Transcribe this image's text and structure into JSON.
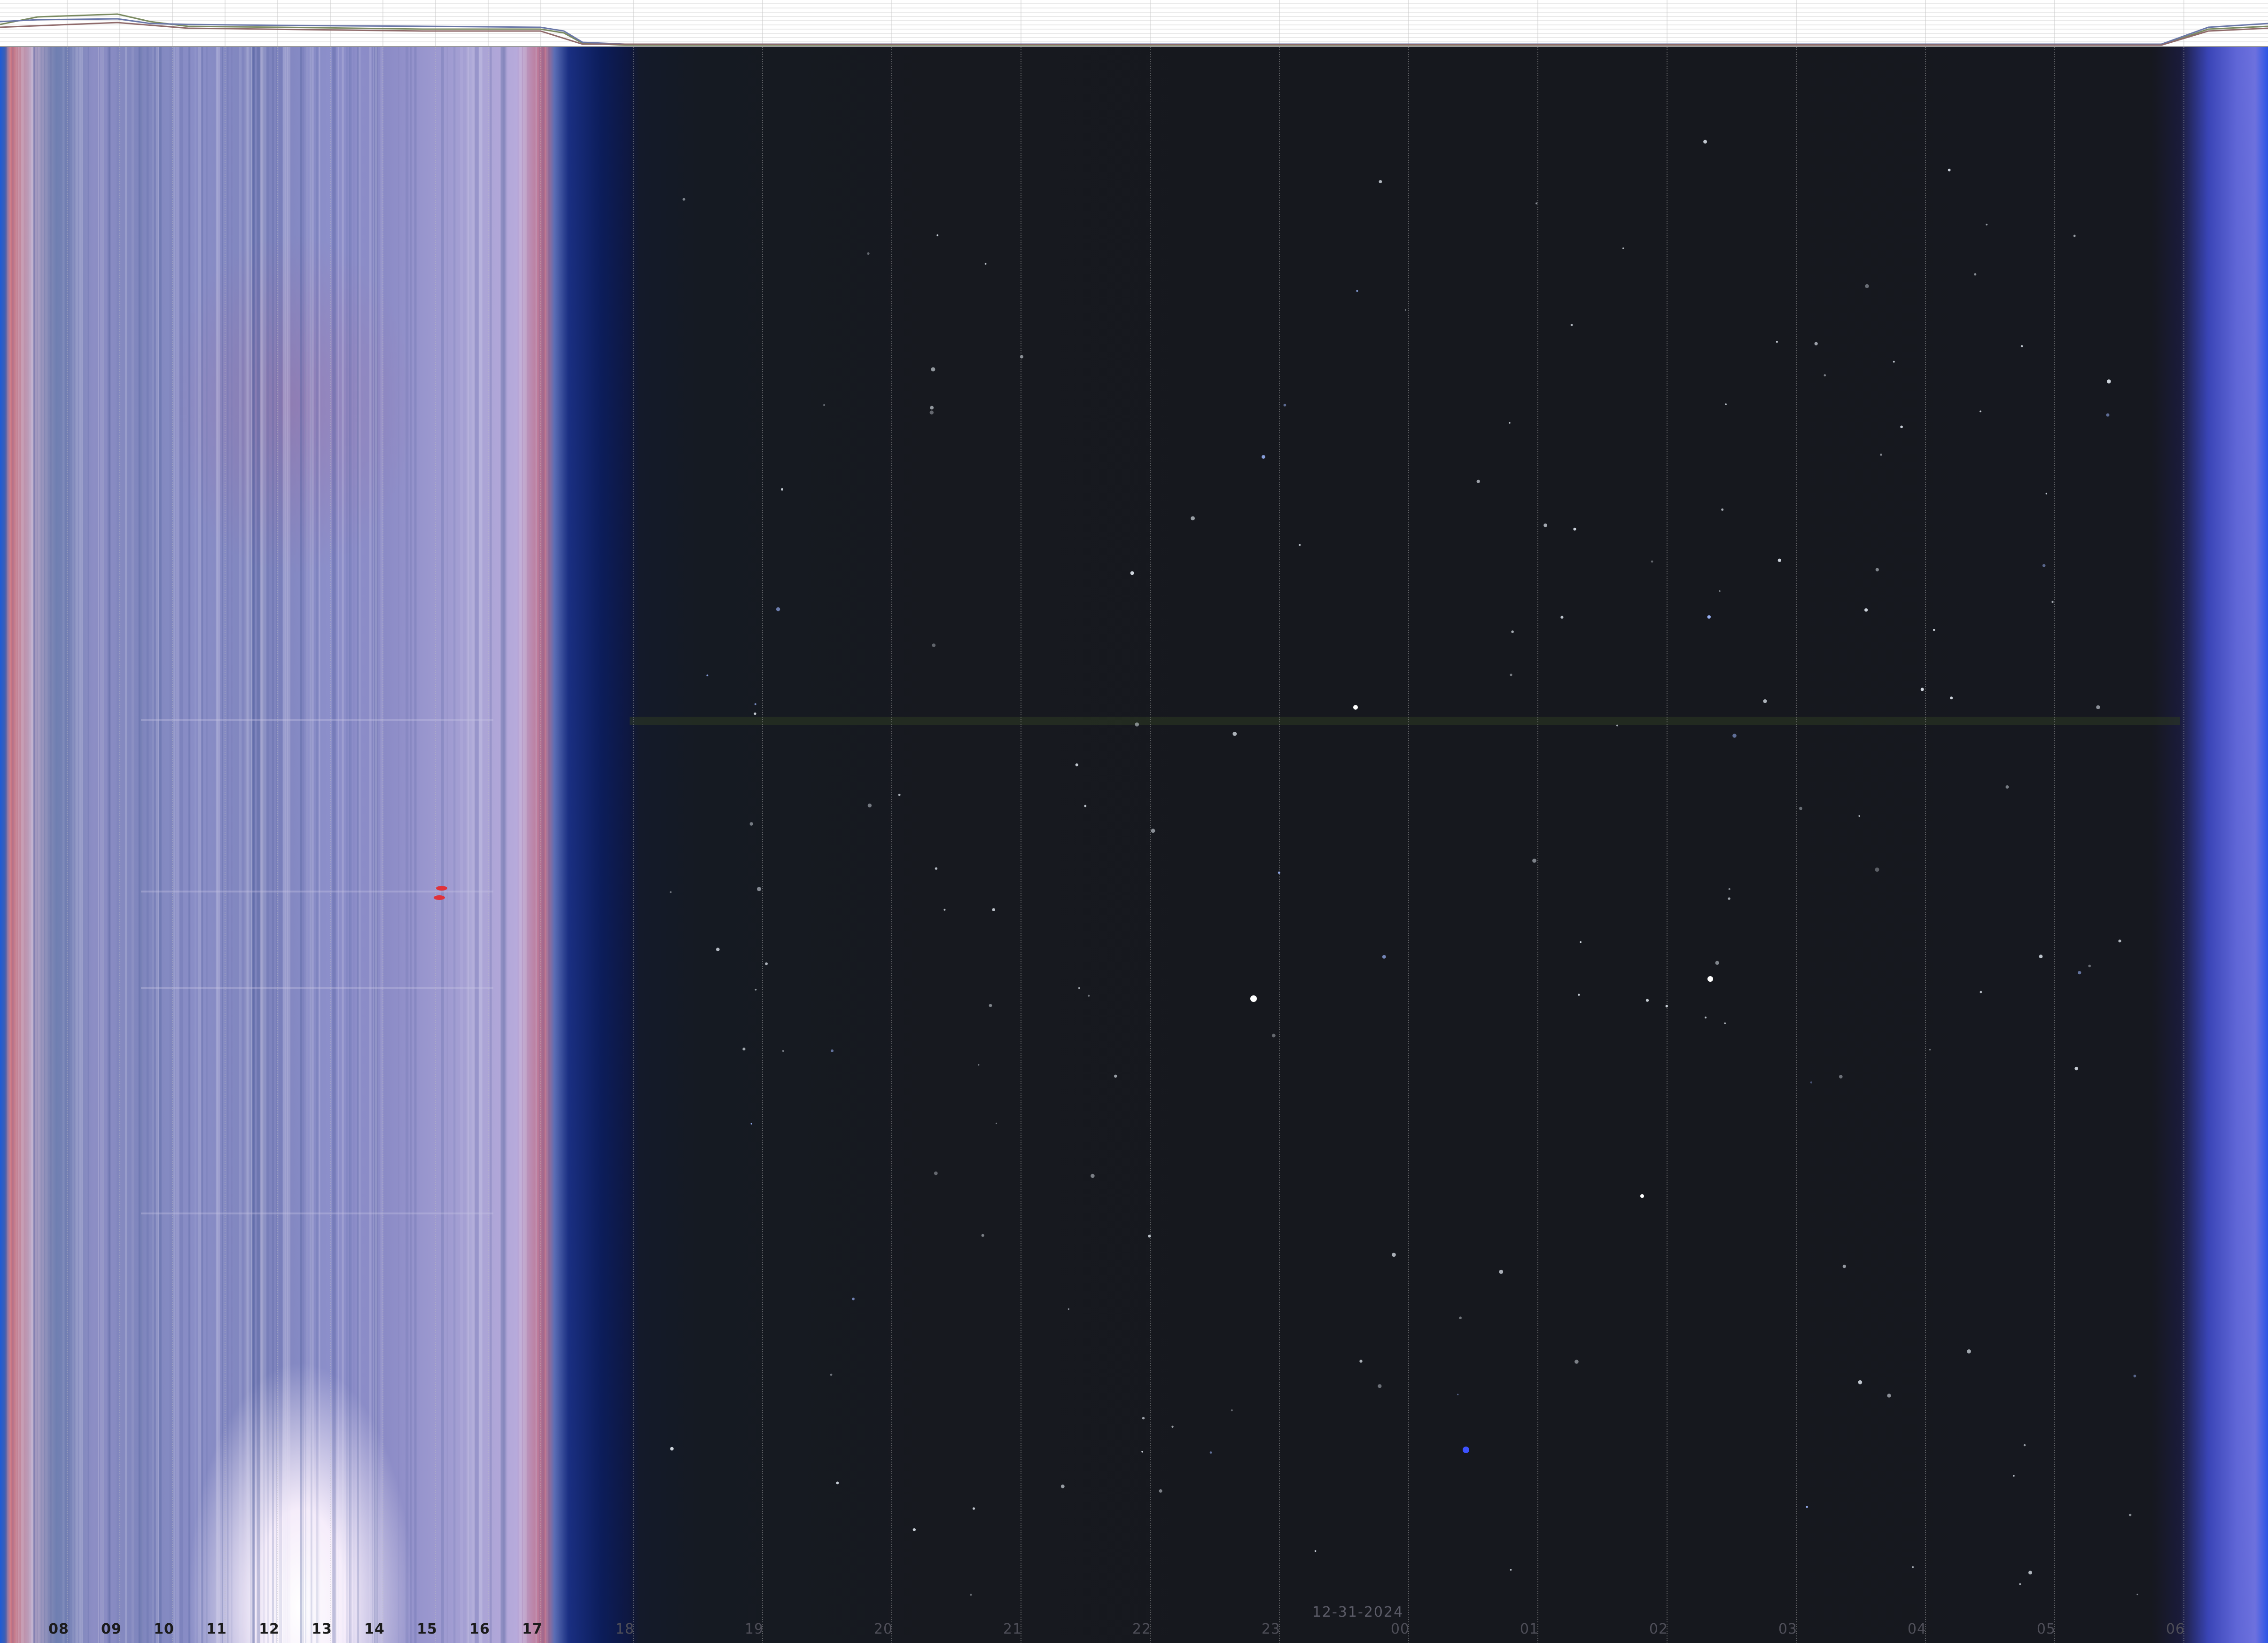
{
  "image": {
    "kind": "keogram",
    "date": "12-31-2024"
  },
  "hour_labels": [
    "08",
    "09",
    "10",
    "11",
    "12",
    "13",
    "14",
    "15",
    "16",
    "17",
    "18",
    "19",
    "20",
    "21",
    "22",
    "23",
    "00",
    "01",
    "02",
    "03",
    "04",
    "05",
    "06"
  ],
  "colors": {
    "day_sky": "#8d8ec5",
    "twilight_blue": "#1a2f82",
    "night_sky": "#16181e",
    "dawn_edge": "#5f66d6",
    "sun_glow": "#ffffff",
    "grid_line": "#bfbfbf",
    "strip_background": "#ffffff"
  }
}
